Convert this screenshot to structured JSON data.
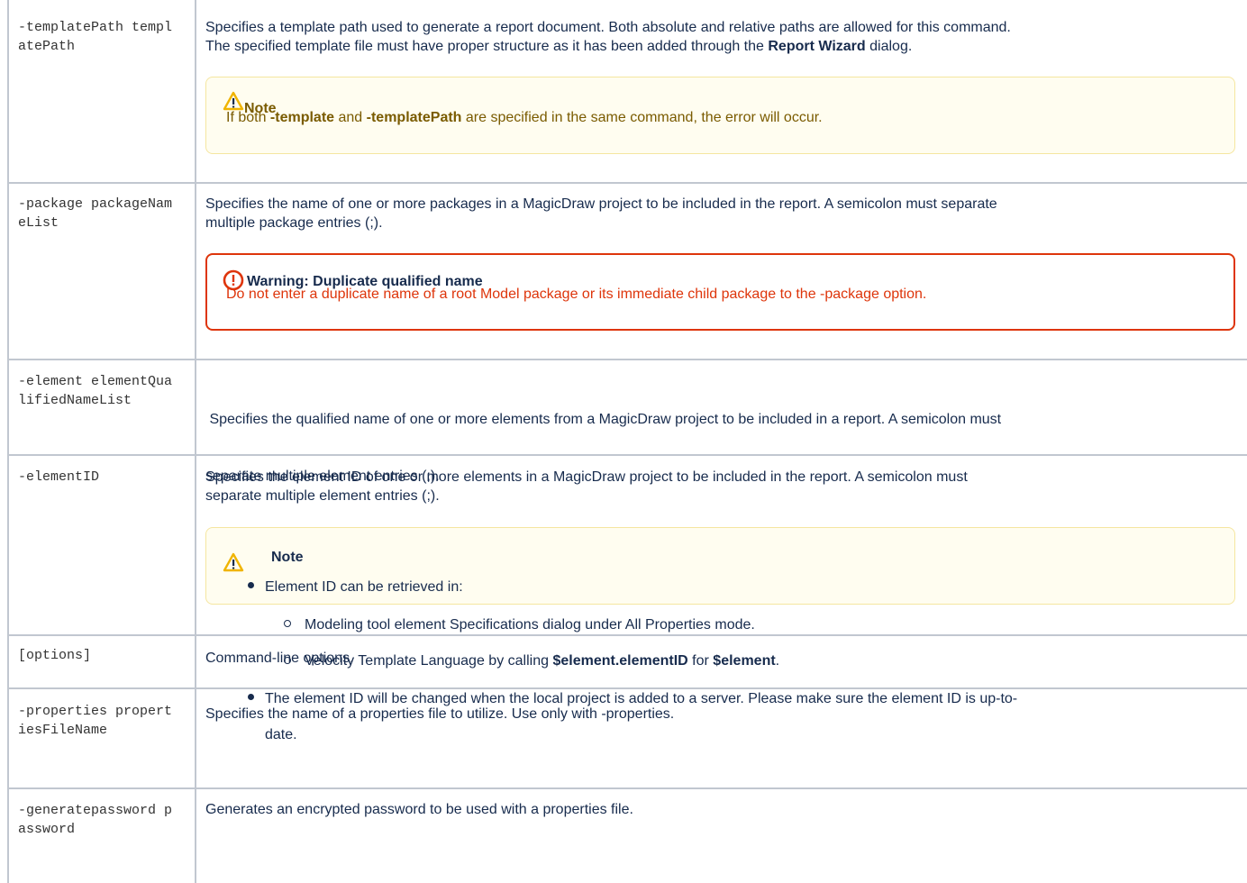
{
  "rows": [
    {
      "option": "-templatePath templatePath",
      "desc_line1": "Specifies a template path used to generate a report document. Both absolute and relative paths are allowed for this command.",
      "desc_line2_pre": "The specified template file must have proper structure as it has been added through the ",
      "desc_line2_bold": "Report Wizard",
      "desc_line2_post": " dialog.",
      "note": {
        "title": "Note",
        "pre": "If both ",
        "bold1": "-template",
        "mid": " and ",
        "bold2": "-templatePath",
        "post": " are specified in the same command, the error will occur."
      }
    },
    {
      "option": "-package packageNameList",
      "desc_line1": "Specifies the name of one or more packages in a MagicDraw project to be included in the report. A semicolon must separate",
      "desc_line2": "multiple package entries (;).",
      "warning": {
        "title": "Warning: Duplicate qualified name",
        "body": "Do not enter a duplicate name of a root Model package or its immediate child package to the -package option."
      }
    },
    {
      "option": "-element elementQualifiedNameList",
      "desc_line1": " Specifies the qualified name of one or more elements from a MagicDraw project to be included in a report. A semicolon must",
      "desc_line2": "separate multiple element entries (;)."
    },
    {
      "option": "-elementID",
      "desc_line1": "Specifies the element ID of one or more elements in a MagicDraw project to be included in the report. A semicolon must",
      "desc_line2": "separate multiple element entries (;).",
      "note": {
        "title": "Note",
        "bullet1": "Element ID can be retrieved in:",
        "sub1": "Modeling tool element Specifications dialog under All Properties mode.",
        "sub2_pre": "Velocity Template Language by calling ",
        "sub2_bold1": "$element.elementID",
        "sub2_mid": " for ",
        "sub2_bold2": "$element",
        "sub2_post": ".",
        "bullet2_line1": "The element ID will be changed when the local project is added to a server. Please make sure the element ID is up-to-",
        "bullet2_line2": "date."
      }
    },
    {
      "option": "[options]",
      "desc_line1": "Command-line options."
    },
    {
      "option": "-properties propertiesFileName",
      "desc_line1": "Specifies the name of a properties file to utilize. Use only with -properties."
    },
    {
      "option": "-generatepassword password",
      "desc_line1": "Generates an encrypted password to be used with a properties file."
    }
  ],
  "colors": {
    "note_title": "#7a5b00",
    "warning_text": "#de350b",
    "note_icon": "#f0b400",
    "warning_icon": "#de350b",
    "table_border": "#c1c7d0"
  },
  "icons": [
    "warning-triangle-icon",
    "error-circle-icon"
  ]
}
